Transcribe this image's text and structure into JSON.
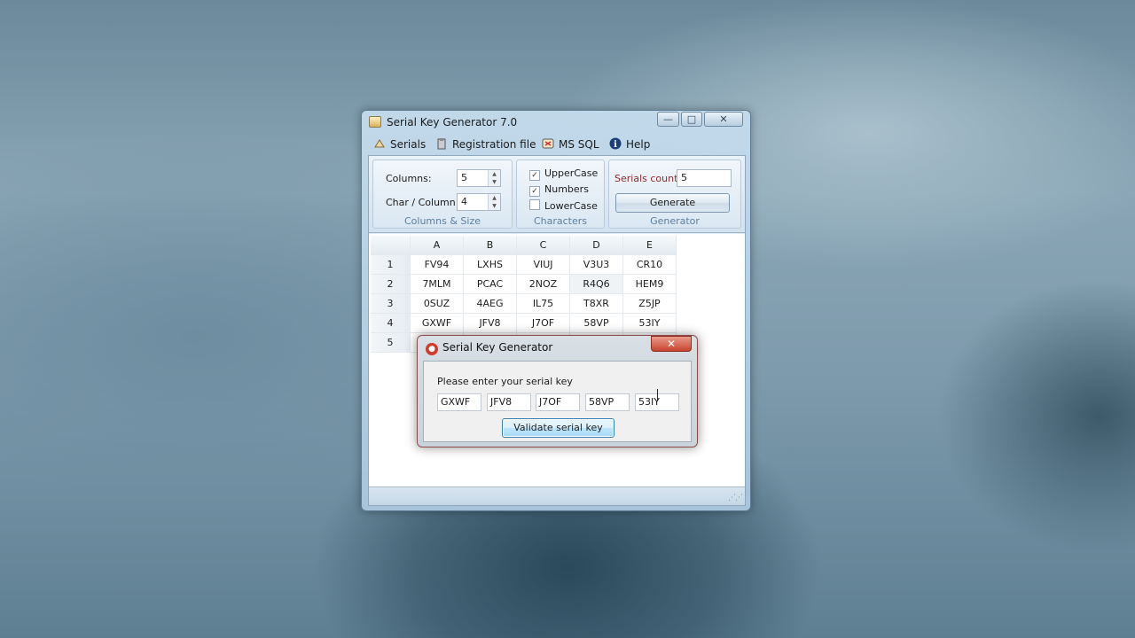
{
  "window": {
    "title": "Serial Key Generator 7.0",
    "buttons": {
      "minimize": "—",
      "maximize": "□",
      "close": "✕"
    }
  },
  "menu": {
    "items": [
      {
        "label": "Serials",
        "icon": "serials-icon"
      },
      {
        "label": "Registration file",
        "icon": "registration-file-icon"
      },
      {
        "label": "MS SQL",
        "icon": "ms-sql-icon"
      },
      {
        "label": "Help",
        "icon": "help-icon"
      }
    ]
  },
  "ribbon": {
    "columns_size": {
      "group_label": "Columns & Size",
      "columns_label": "Columns:",
      "columns_value": "5",
      "char_label": "Char / Column:",
      "char_value": "4"
    },
    "characters": {
      "group_label": "Characters",
      "options": [
        {
          "label": "UpperCase",
          "checked": true
        },
        {
          "label": "Numbers",
          "checked": true
        },
        {
          "label": "LowerCase",
          "checked": false
        }
      ]
    },
    "generator": {
      "group_label": "Generator",
      "count_label": "Serials count:",
      "count_value": "5",
      "generate_label": "Generate"
    }
  },
  "grid": {
    "columns": [
      "A",
      "B",
      "C",
      "D",
      "E"
    ],
    "rows": [
      {
        "num": "1",
        "cells": [
          "FV94",
          "LXHS",
          "VIUJ",
          "V3U3",
          "CR10"
        ]
      },
      {
        "num": "2",
        "cells": [
          "7MLM",
          "PCAC",
          "2NOZ",
          "R4Q6",
          "HEM9"
        ]
      },
      {
        "num": "3",
        "cells": [
          "0SUZ",
          "4AEG",
          "IL75",
          "T8XR",
          "Z5JP"
        ]
      },
      {
        "num": "4",
        "cells": [
          "GXWF",
          "JFV8",
          "J7OF",
          "58VP",
          "53IY"
        ]
      },
      {
        "num": "5",
        "cells": [
          "",
          "",
          "",
          "",
          ""
        ]
      }
    ]
  },
  "dialog": {
    "title": "Serial Key Generator",
    "close": "✕",
    "prompt": "Please enter your serial key",
    "keys": [
      "GXWF",
      "JFV8",
      "J7OF",
      "58VP",
      "53IY"
    ],
    "validate_label": "Validate serial key"
  }
}
